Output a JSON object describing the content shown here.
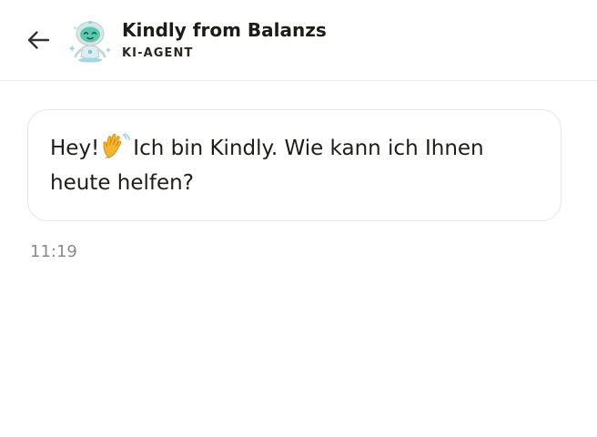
{
  "header": {
    "back_icon": "arrow-left-icon",
    "avatar_icon": "robot-avatar-icon",
    "agent_name": "Kindly from Balanzs",
    "agent_role": "KI-AGENT"
  },
  "message": {
    "text_before": "Hey!",
    "emoji": "waving-hand-icon",
    "text_after": "Ich bin Kindly. Wie kann ich Ihnen heute helfen?",
    "time": "11:19"
  },
  "colors": {
    "text": "#1f1c19",
    "muted": "#8b8b8b",
    "border": "#e6e6e6"
  }
}
